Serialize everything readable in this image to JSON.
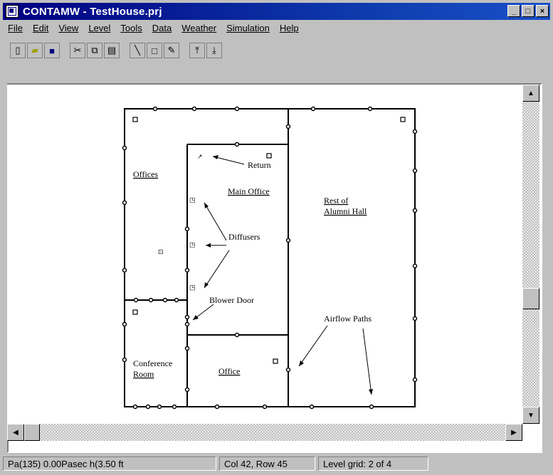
{
  "window": {
    "title": "CONTAMW - TestHouse.prj",
    "minimize_icon": "minimize-icon",
    "maximize_icon": "maximize-icon",
    "close_icon": "close-icon"
  },
  "menu": [
    {
      "label": "File"
    },
    {
      "label": "Edit"
    },
    {
      "label": "View"
    },
    {
      "label": "Level"
    },
    {
      "label": "Tools"
    },
    {
      "label": "Data"
    },
    {
      "label": "Weather"
    },
    {
      "label": "Simulation"
    },
    {
      "label": "Help"
    }
  ],
  "toolbar": {
    "icons": [
      "new-file-icon",
      "open-file-icon",
      "save-icon",
      "cut-icon",
      "copy-icon",
      "paste-icon",
      "wall-tool-icon",
      "box-tool-icon",
      "erase-tool-icon",
      "level-up-icon",
      "level-down-icon"
    ]
  },
  "plan": {
    "labels": {
      "offices": "Offices",
      "main_office": "Main Office",
      "rest_of": "Rest of",
      "alumni_hall": "Alumni Hall",
      "return": "Return",
      "diffusers": "Diffusers",
      "blower_door": "Blower Door",
      "airflow_paths": "Airflow Paths",
      "conference": "Conference",
      "room": "Room",
      "office": "Office"
    }
  },
  "statusbar": {
    "pane1": "Pa(135) 0.00Pasec h(3.50 ft",
    "pane2": "Col 42, Row 45",
    "pane3": "Level grid: 2 of 4"
  },
  "colors": {
    "title_bar": "#000080",
    "face": "#c0c0c0",
    "canvas": "#ffffff"
  }
}
